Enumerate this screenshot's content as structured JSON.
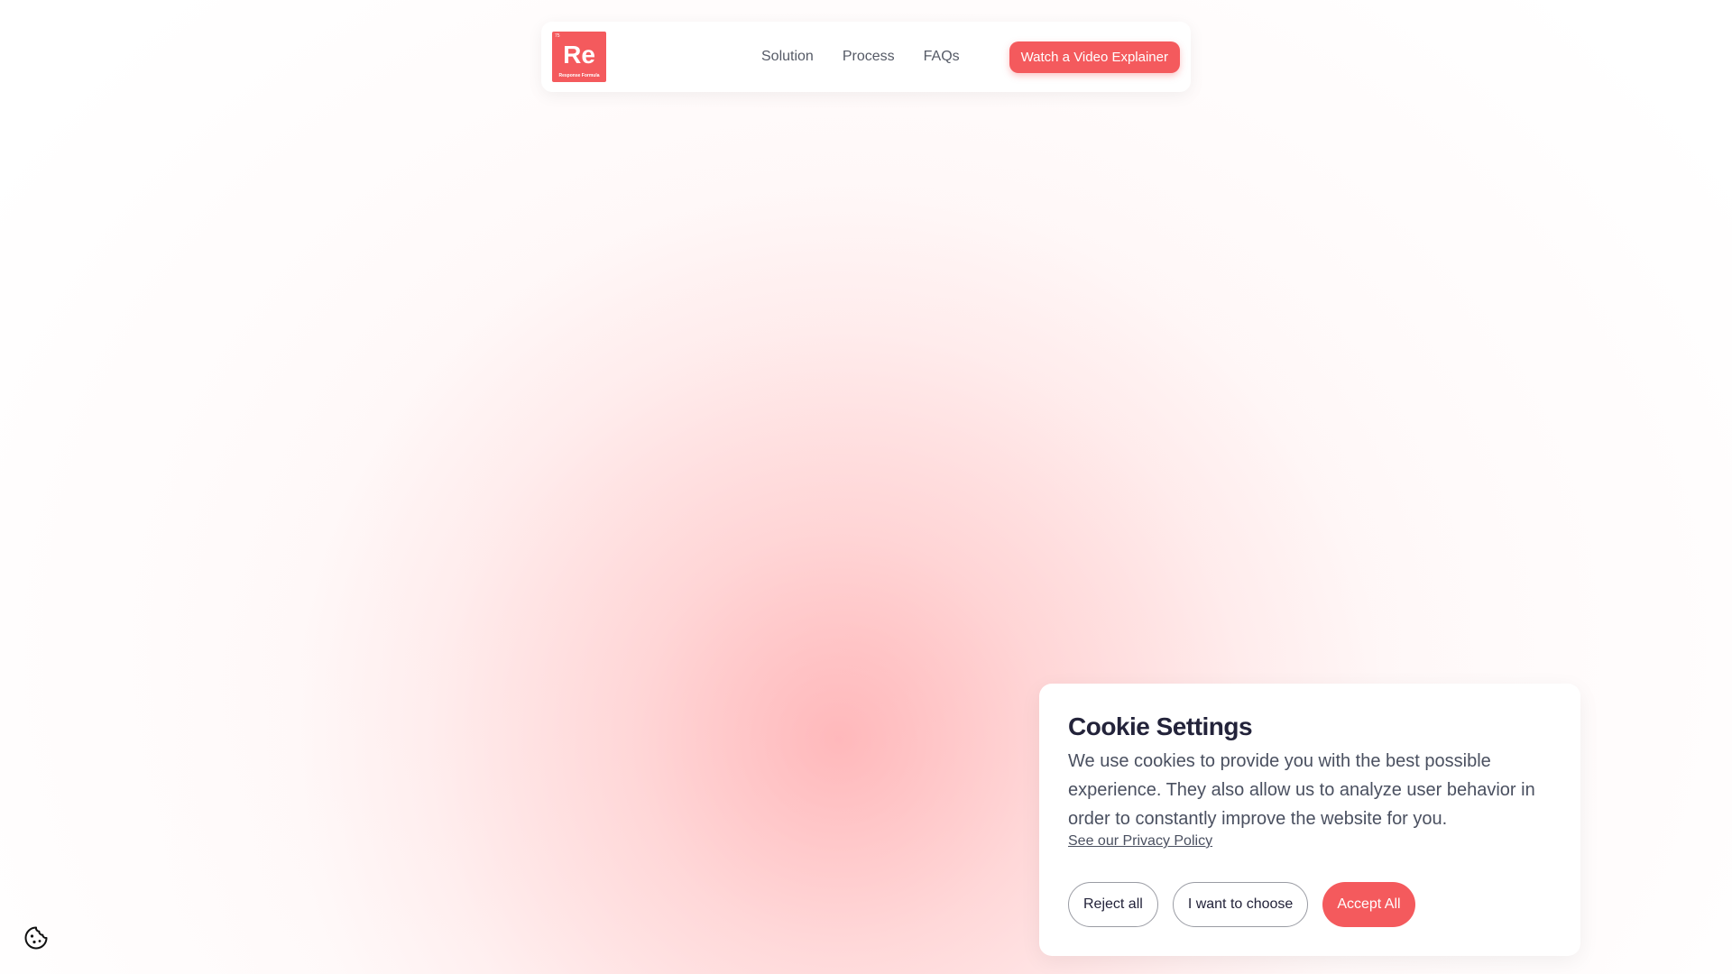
{
  "nav": {
    "logo": {
      "number": "75",
      "symbol": "Re",
      "subtitle": "Response Formula"
    },
    "links": [
      "Solution",
      "Process",
      "FAQs"
    ],
    "cta_label": "Watch a Video Explainer"
  },
  "cookie": {
    "title": "Cookie Settings",
    "body": "We use cookies to provide you with the best possible experience. They also allow us to analyze user behavior in order to constantly improve the website for you.",
    "privacy_link": "See our Privacy Policy",
    "reject_label": "Reject all",
    "choose_label": "I want to choose",
    "accept_label": "Accept All"
  },
  "colors": {
    "accent": "#f45a5d",
    "heading": "#23233a",
    "body_text": "#4a5060"
  },
  "icons": {
    "cookie_settings": "cookie-icon"
  }
}
